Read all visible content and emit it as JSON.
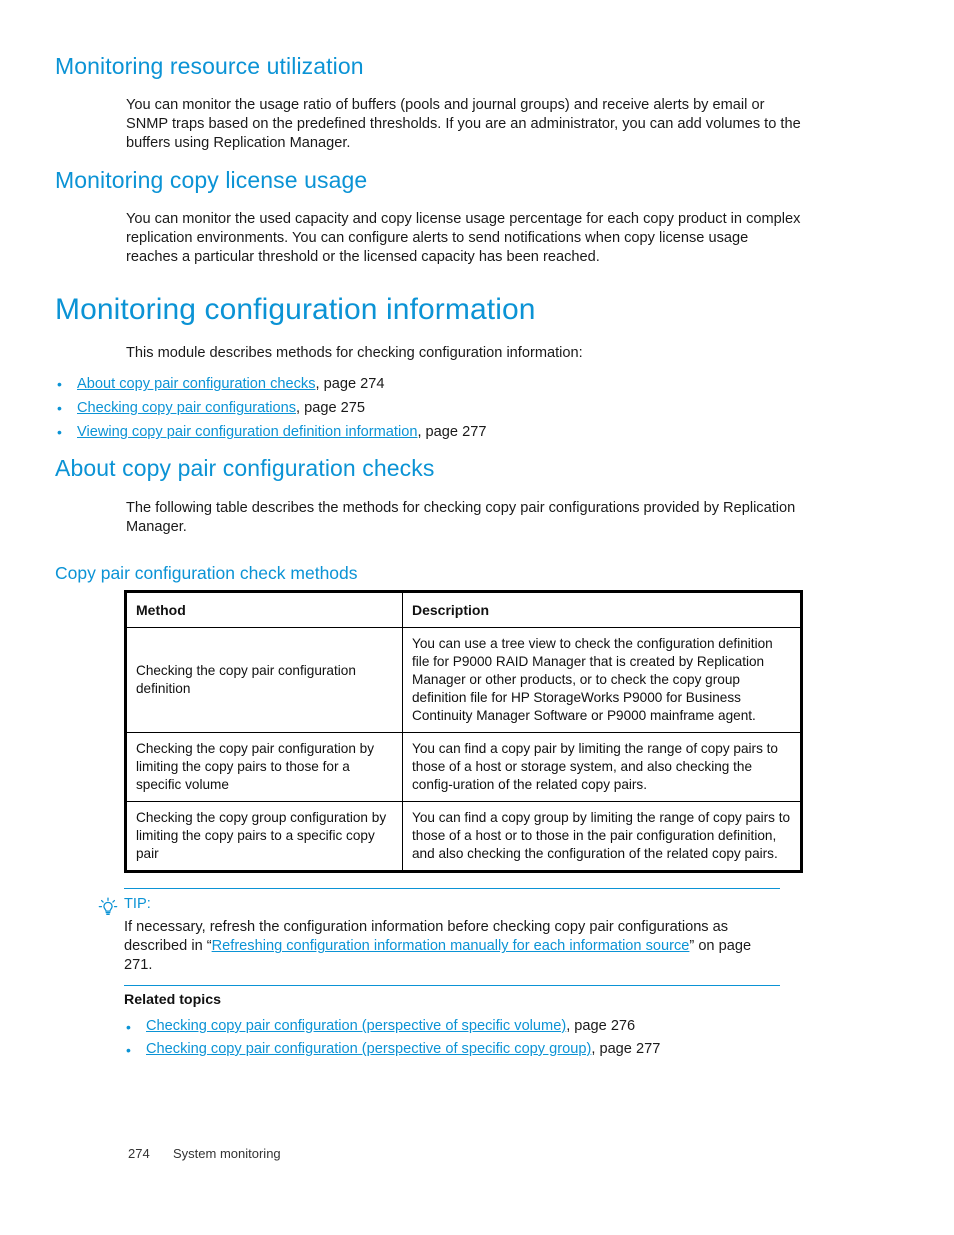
{
  "colors": {
    "accent": "#0b93d5",
    "text": "#1a1a1a",
    "border": "#000000"
  },
  "sections": {
    "resource_utilization": {
      "heading": "Monitoring resource utilization",
      "paragraph": "You can monitor the usage ratio of buffers (pools and journal groups) and receive alerts by email or SNMP traps based on the predefined thresholds. If you are an administrator, you can add volumes to the buffers using Replication Manager."
    },
    "copy_license_usage": {
      "heading": "Monitoring copy license usage",
      "paragraph": "You can monitor the used capacity and copy license usage percentage for each copy product in complex replication environments. You can configure alerts to send notifications when copy license usage reaches a particular threshold or the licensed capacity has been reached."
    },
    "configuration_information": {
      "heading": "Monitoring configuration information",
      "intro": "This module describes methods for checking configuration information:",
      "links": [
        {
          "label": "About copy pair configuration checks",
          "suffix": ", page 274"
        },
        {
          "label": "Checking copy pair configurations",
          "suffix": ", page 275"
        },
        {
          "label": "Viewing copy pair configuration definition information",
          "suffix": ", page 277"
        }
      ]
    },
    "about_checks": {
      "heading": "About copy pair configuration checks",
      "paragraph": "The following table describes the methods for checking copy pair configurations provided by Replication Manager.",
      "table_caption": "Copy pair configuration check methods"
    }
  },
  "table": {
    "columns": [
      "Method",
      "Description"
    ],
    "rows": [
      {
        "method": "Checking the copy pair configuration definition",
        "description": "You can use a tree view to check the configuration definition file for P9000 RAID Manager that is created by Replication Manager or other products, or to check the copy group definition file for HP StorageWorks P9000 for Business Continuity Manager Software or P9000 mainframe agent."
      },
      {
        "method": "Checking the copy pair configuration by limiting the copy pairs to those for a specific volume",
        "description": "You can find a copy pair by limiting the range of copy pairs to those of a host or storage system, and also checking the config‐uration of the related copy pairs."
      },
      {
        "method": "Checking the copy group configuration by limiting the copy pairs to a specific copy pair",
        "description": "You can find a copy group by limiting the range of copy pairs to those of a host or to those in the pair configuration definition, and also checking the configuration of the related copy pairs."
      }
    ]
  },
  "tip": {
    "icon": "lightbulb-icon",
    "label": "TIP:",
    "text_before": "If necessary, refresh the configuration information before checking copy pair configurations as described in “",
    "link": "Refreshing configuration information manually for each information source",
    "text_after": "” on page 271."
  },
  "related_topics": {
    "title": "Related topics",
    "links": [
      {
        "label": "Checking copy pair configuration (perspective of specific volume)",
        "suffix": ", page 276"
      },
      {
        "label": "Checking copy pair configuration (perspective of specific copy group)",
        "suffix": ", page 277"
      }
    ]
  },
  "footer": {
    "page_number": "274",
    "section_name": "System monitoring"
  }
}
